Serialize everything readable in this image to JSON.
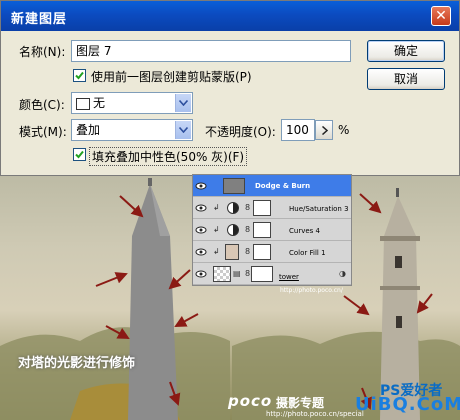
{
  "dialog": {
    "title": "新建图层",
    "name_label": "名称(N):",
    "name_value": "图层 7",
    "clip_checkbox_label": "使用前一图层创建剪贴蒙版(P)",
    "clip_checked": true,
    "color_label": "颜色(C):",
    "color_value": "无",
    "mode_label": "模式(M):",
    "mode_value": "叠加",
    "opacity_label": "不透明度(O):",
    "opacity_value": "100",
    "opacity_unit": "%",
    "fill_checkbox_label": "填充叠加中性色(50% 灰)(F)",
    "fill_checked": true,
    "ok_label": "确定",
    "cancel_label": "取消",
    "close_glyph": "✕"
  },
  "layers": [
    {
      "name": "Dodge & Burn",
      "selected": true
    },
    {
      "name": "Hue/Saturation 3",
      "selected": false
    },
    {
      "name": "Curves 4",
      "selected": false
    },
    {
      "name": "Color Fill 1",
      "selected": false
    },
    {
      "name": "tower",
      "selected": false
    }
  ],
  "layers_url": "http://photo.poco.cn/",
  "canvas": {
    "caption": "对塔的光影进行修饰",
    "poco_logo": "poco",
    "poco_label": "摄影专题",
    "poco_url": "http://photo.poco.cn/special",
    "watermark_ps": "PS爱好者",
    "watermark_site": "UiBQ.CoM"
  },
  "colors": {
    "titlebar": "#0b4bc0",
    "layer_selected": "#3e7ce8",
    "arrow": "#8b1a14"
  }
}
